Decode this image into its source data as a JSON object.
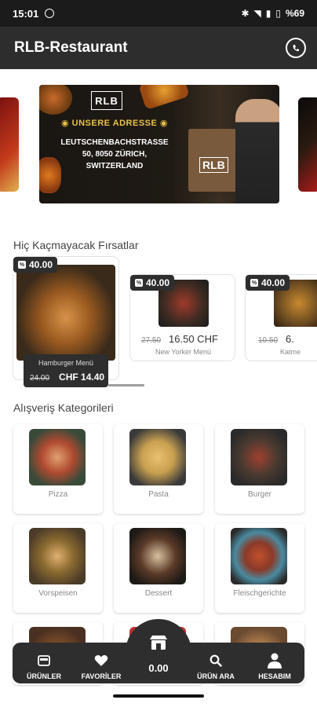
{
  "status_bar": {
    "time": "15:01",
    "battery": "%69"
  },
  "app_bar": {
    "title": "RLB-Restaurant",
    "whatsapp_icon": "whatsapp-icon"
  },
  "banner": {
    "logo": "RLB",
    "heading": "UNSERE ADRESSE",
    "address_lines": [
      "LEUTSCHENBACHSTRASSE",
      "50, 8050 ZÜRICH,",
      "SWITZERLAND"
    ],
    "bag_logo": "RLB"
  },
  "deals_section": {
    "title": "Hiç Kaçmayacak Fırsatlar",
    "items": [
      {
        "badge": "40.00",
        "name": "Hamburger Menü",
        "old_price": "24.00",
        "new_price": "CHF 14.40"
      },
      {
        "badge": "40.00",
        "name": "New Yorker Menü",
        "old_price": "27.50",
        "new_price": "16.50 CHF"
      },
      {
        "badge": "40.00",
        "name": "Katme",
        "old_price": "10.50",
        "new_price": "6."
      }
    ]
  },
  "categories_section": {
    "title": "Alışveriş Kategorileri",
    "items": [
      {
        "label": "Pizza"
      },
      {
        "label": "Pasta"
      },
      {
        "label": "Burger"
      },
      {
        "label": "Vorspeisen"
      },
      {
        "label": "Dessert"
      },
      {
        "label": "Fleischgerichte"
      }
    ]
  },
  "bottom_nav": {
    "products": "ÜRÜNLER",
    "favorites": "FAVORİLER",
    "cart_total": "0.00",
    "search": "ÜRÜN ARA",
    "account": "HESABIM"
  }
}
